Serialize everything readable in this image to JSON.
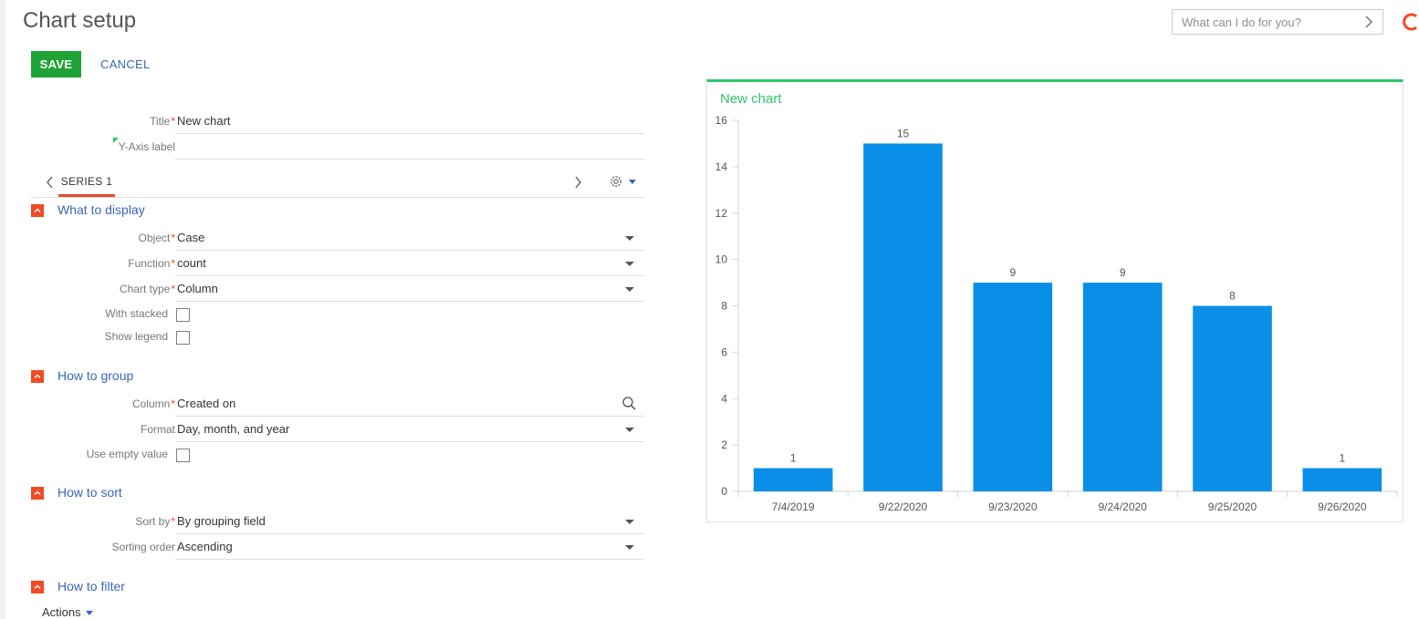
{
  "page": {
    "title": "Chart setup"
  },
  "command_box": {
    "placeholder": "What can I do for you?"
  },
  "toolbar": {
    "save_label": "SAVE",
    "cancel_label": "CANCEL"
  },
  "fields": {
    "title": {
      "label": "Title",
      "value": "New chart"
    },
    "y_axis_label": {
      "label": "Y-Axis label",
      "value": ""
    }
  },
  "series": {
    "tab_label": "SERIES 1"
  },
  "sections": {
    "what_to_display": {
      "title": "What to display",
      "object": {
        "label": "Object",
        "value": "Case"
      },
      "function": {
        "label": "Function",
        "value": "count"
      },
      "chart_type": {
        "label": "Chart type",
        "value": "Column"
      },
      "with_stacked": {
        "label": "With stacked",
        "checked": false
      },
      "show_legend": {
        "label": "Show legend",
        "checked": false
      }
    },
    "how_to_group": {
      "title": "How to group",
      "column": {
        "label": "Column",
        "value": "Created on"
      },
      "format": {
        "label": "Format",
        "value": "Day, month, and year"
      },
      "use_empty_value": {
        "label": "Use empty value",
        "checked": false
      }
    },
    "how_to_sort": {
      "title": "How to sort",
      "sort_by": {
        "label": "Sort by",
        "value": "By grouping field"
      },
      "sorting_order": {
        "label": "Sorting order",
        "value": "Ascending"
      }
    },
    "how_to_filter": {
      "title": "How to filter"
    }
  },
  "actions": {
    "label": "Actions"
  },
  "colors": {
    "save": "#1fa336",
    "link": "#3a67b8",
    "required": "#e84a2a",
    "section_toggle": "#f04b23",
    "chart_title": "#2ec76a",
    "bar": "#0a8fe8"
  },
  "icons": {
    "command_arrow": "chevron-right-icon",
    "series_prev": "chevron-left-icon",
    "series_next": "chevron-right-icon",
    "settings": "gear-icon",
    "lookup": "search-icon",
    "brand": "logo-c-icon"
  },
  "chart_data": {
    "type": "bar",
    "title": "New chart",
    "categories": [
      "7/4/2019",
      "9/22/2020",
      "9/23/2020",
      "9/24/2020",
      "9/25/2020",
      "9/26/2020"
    ],
    "values": [
      1,
      15,
      9,
      9,
      8,
      1
    ],
    "ylim": [
      0,
      16
    ],
    "yticks": [
      0,
      2,
      4,
      6,
      8,
      10,
      12,
      14,
      16
    ],
    "xlabel": "",
    "ylabel": "",
    "data_labels": true,
    "grid": false,
    "legend": false
  }
}
